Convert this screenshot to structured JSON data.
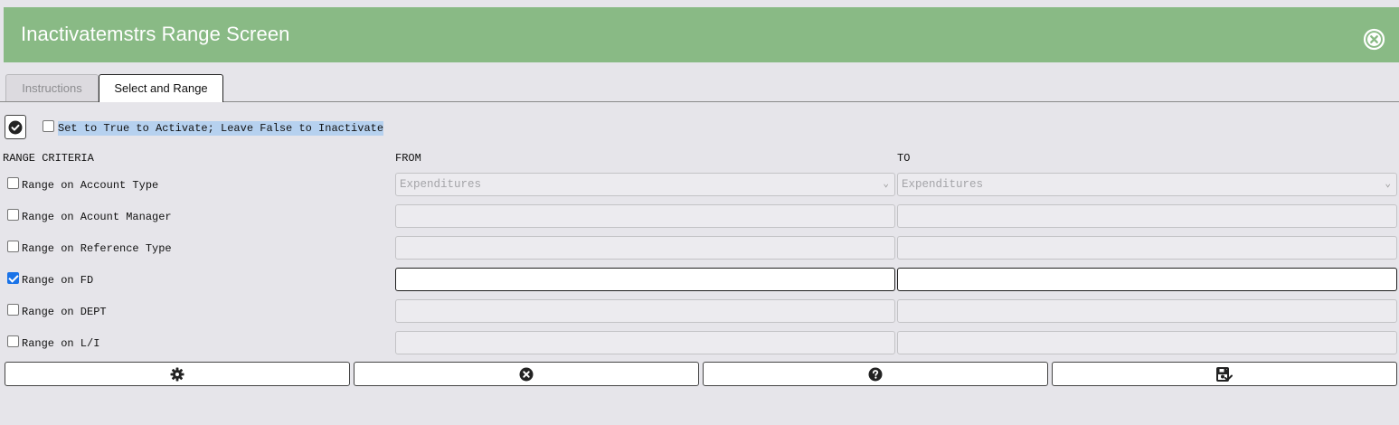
{
  "window": {
    "title": "Inactivatemstrs Range Screen",
    "close_icon": "close-circle-icon"
  },
  "tabs": [
    {
      "label": "Instructions",
      "active": false
    },
    {
      "label": "Select and Range",
      "active": true
    }
  ],
  "activate": {
    "button_icon": "check-circle-icon",
    "checkbox_checked": false,
    "label": "Set to True to Activate; Leave False to Inactivate"
  },
  "headers": {
    "criteria": "RANGE CRITERIA",
    "from": "FROM",
    "to": "TO"
  },
  "rows": [
    {
      "label": "Range on Account Type",
      "checked": false,
      "from": "Expenditures",
      "to": "Expenditures",
      "type": "select"
    },
    {
      "label": "Range on Acount Manager",
      "checked": false,
      "from": "",
      "to": "",
      "type": "text"
    },
    {
      "label": "Range on Reference Type",
      "checked": false,
      "from": "",
      "to": "",
      "type": "text"
    },
    {
      "label": "Range on FD",
      "checked": true,
      "from": "",
      "to": "",
      "type": "text"
    },
    {
      "label": "Range on DEPT",
      "checked": false,
      "from": "",
      "to": "",
      "type": "text"
    },
    {
      "label": "Range on L/I",
      "checked": false,
      "from": "",
      "to": "",
      "type": "text"
    }
  ],
  "actions": [
    {
      "name": "settings-button",
      "icon": "gear-icon"
    },
    {
      "name": "cancel-button",
      "icon": "close-circle-icon"
    },
    {
      "name": "help-button",
      "icon": "question-circle-icon"
    },
    {
      "name": "save-button",
      "icon": "save-check-icon"
    }
  ]
}
